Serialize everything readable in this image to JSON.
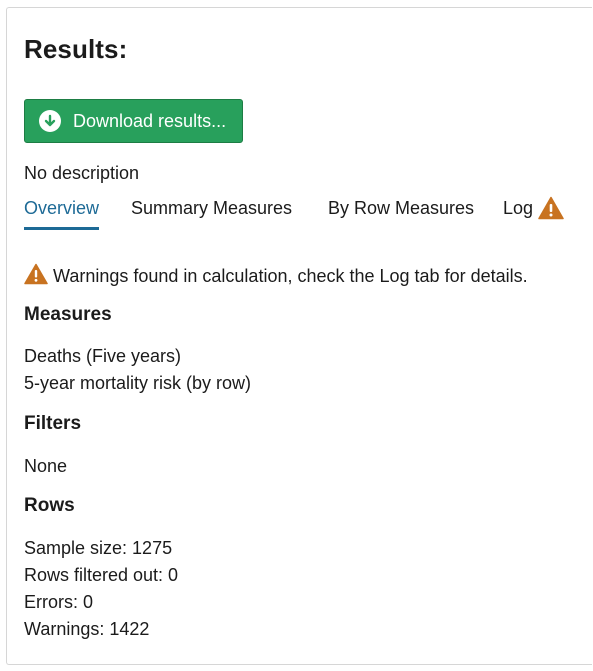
{
  "title": "Results:",
  "download_button": {
    "label": "Download results..."
  },
  "description": "No description",
  "tabs": [
    {
      "label": "Overview",
      "active": true
    },
    {
      "label": "Summary Measures",
      "active": false
    },
    {
      "label": "By Row Measures",
      "active": false
    },
    {
      "label": "Log",
      "active": false,
      "icon": "warning-icon"
    }
  ],
  "warning_message": "Warnings found in calculation, check the Log tab for details.",
  "measures": {
    "heading": "Measures",
    "items": [
      "Deaths (Five years)",
      "5-year mortality risk (by row)"
    ]
  },
  "filters": {
    "heading": "Filters",
    "value": "None"
  },
  "rows": {
    "heading": "Rows",
    "sample_size": "Sample size: 1275",
    "rows_filtered_out": "Rows filtered out: 0",
    "errors": "Errors: 0",
    "warnings": "Warnings: 1422"
  },
  "colors": {
    "accent": "#1d6a96",
    "button": "#28a05c",
    "warning": "#c87321"
  }
}
